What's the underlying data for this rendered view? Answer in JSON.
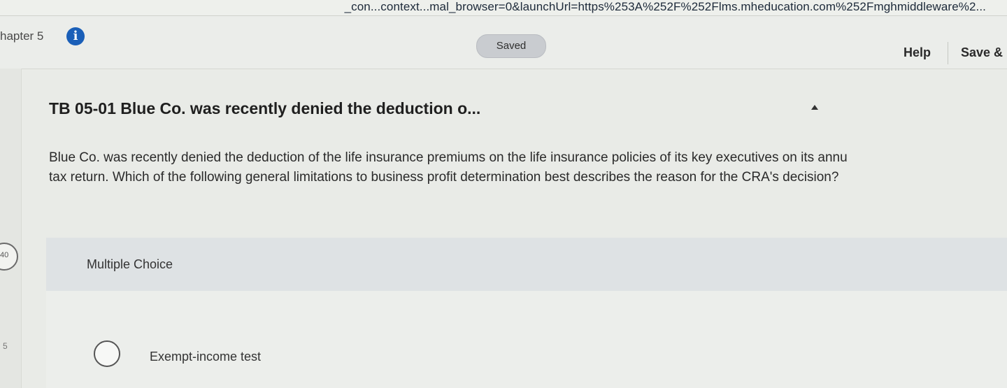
{
  "browser": {
    "url_fragment": "_con...context...mal_browser=0&launchUrl=https%253A%252F%252Flms.mheducation.com%252Fmghmiddleware%2..."
  },
  "header": {
    "chapter": "hapter 5",
    "saved_status": "Saved",
    "help_label": "Help",
    "save_exit_label": "Save &"
  },
  "sidebar": {
    "points": "40",
    "marker": "5"
  },
  "question": {
    "title": "TB 05-01 Blue Co. was recently denied the deduction o...",
    "body_line1": "Blue Co. was recently denied the deduction of the life insurance premiums on the life insurance policies of its key executives on its annu",
    "body_line2": "tax return. Which of the following general limitations to business profit determination best describes the reason for the CRA's decision?",
    "type_label": "Multiple Choice"
  },
  "choices": [
    {
      "label": "Exempt-income test",
      "selected": false
    }
  ],
  "colors": {
    "info_icon": "#1a5fb8",
    "saved_badge": "#c9ccd0",
    "mc_band": "#dee2e4"
  }
}
